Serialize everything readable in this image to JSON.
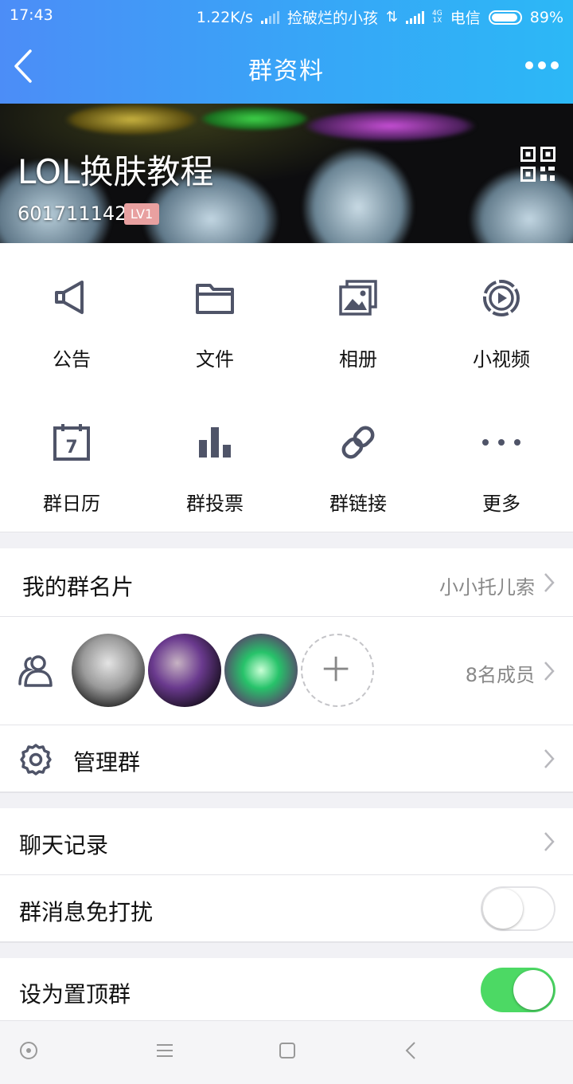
{
  "status_bar": {
    "time": "17:43",
    "net_speed": "1.22K/s",
    "notification": "捡破烂的小孩",
    "carrier": "电信",
    "network_top": "4G",
    "network_bottom": "1X",
    "battery": "89%"
  },
  "nav": {
    "title": "群资料",
    "back_icon": "back-arrow-icon",
    "more_icon": "more-dots-icon"
  },
  "group": {
    "name": "LOL换肤教程",
    "id": "601711142",
    "level": "LV1"
  },
  "features": [
    {
      "label": "公告",
      "icon": "megaphone-icon"
    },
    {
      "label": "文件",
      "icon": "folder-icon"
    },
    {
      "label": "相册",
      "icon": "album-icon"
    },
    {
      "label": "小视频",
      "icon": "video-icon"
    },
    {
      "label": "群日历",
      "icon": "calendar-icon"
    },
    {
      "label": "群投票",
      "icon": "vote-icon"
    },
    {
      "label": "群链接",
      "icon": "link-icon"
    },
    {
      "label": "更多",
      "icon": "more-icon"
    }
  ],
  "calendar_day": "7",
  "card": {
    "title": "我的群名片",
    "value": "小小托儿索"
  },
  "members": {
    "count_label": "8名成员"
  },
  "manage": {
    "title": "管理群"
  },
  "chat_history": {
    "title": "聊天记录"
  },
  "mute": {
    "title": "群消息免打扰",
    "on": false
  },
  "pin": {
    "title": "设为置顶群",
    "on": true
  },
  "colors": {
    "accent": "#3b9ff6",
    "icon_gray": "#4f5468",
    "toggle_on": "#4cd964"
  }
}
